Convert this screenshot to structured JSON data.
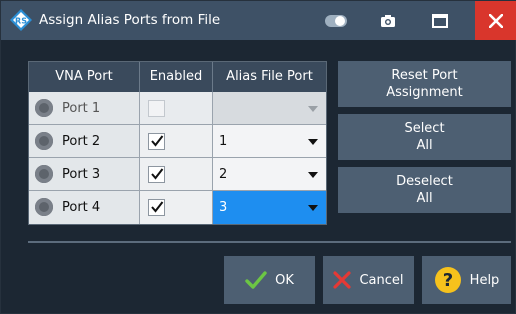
{
  "window": {
    "title": "Assign Alias Ports from File"
  },
  "titlebar_buttons": [
    "toggle-icon",
    "camera-icon",
    "maximize-icon",
    "close-icon"
  ],
  "table": {
    "columns": [
      "VNA Port",
      "Enabled",
      "Alias File Port"
    ],
    "rows": [
      {
        "port": "Port 1",
        "enabled": false,
        "alias": "",
        "state": "disabled"
      },
      {
        "port": "Port 2",
        "enabled": true,
        "alias": "1",
        "state": "normal"
      },
      {
        "port": "Port 3",
        "enabled": true,
        "alias": "2",
        "state": "normal"
      },
      {
        "port": "Port 4",
        "enabled": true,
        "alias": "3",
        "state": "selected"
      }
    ]
  },
  "side_buttons": {
    "reset_line1": "Reset Port",
    "reset_line2": "Assignment",
    "select_line1": "Select",
    "select_line2": "All",
    "deselect_line1": "Deselect",
    "deselect_line2": "All"
  },
  "footer": {
    "ok_label": "OK",
    "cancel_label": "Cancel",
    "help_label": "Help"
  },
  "colors": {
    "titlebar": "#3e5166",
    "background": "#1c2733",
    "button": "#4d5f72",
    "close": "#d9362c",
    "selection": "#1e8ef0",
    "ok_check": "#6cc644",
    "cancel_x": "#e53935",
    "help": "#f6c21c"
  }
}
